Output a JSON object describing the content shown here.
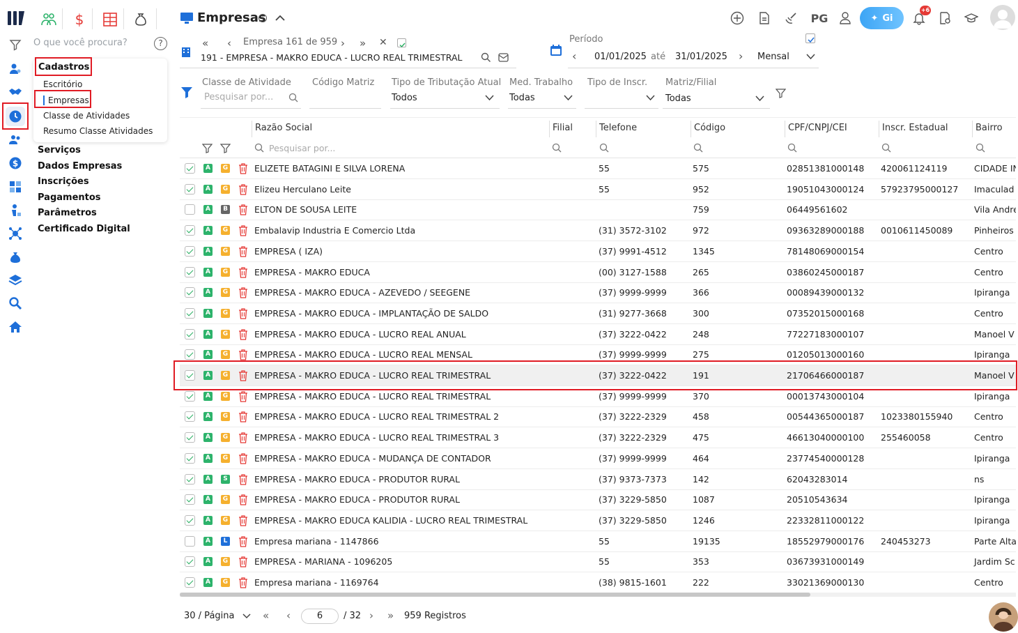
{
  "sidebar": {
    "search_placeholder": "O que você procura?",
    "help": "?",
    "menu": {
      "title": "Cadastros",
      "sub_items": [
        "Escritório",
        "Empresas",
        "Classe de Atividades",
        "Resumo Classe Atividades"
      ],
      "items": [
        "Serviços",
        "Dados Empresas",
        "Inscrições",
        "Pagamentos",
        "Parâmetros",
        "Certificado Digital"
      ]
    }
  },
  "header": {
    "title": "Empresas",
    "pg_label": "PG",
    "gi_label": "Gi",
    "notif_count": "+6"
  },
  "company_nav": {
    "counter": "Empresa 161 de 959",
    "current": "191 - EMPRESA - MAKRO EDUCA - LUCRO REAL TRIMESTRAL"
  },
  "period": {
    "label": "Período",
    "start": "01/01/2025",
    "sep": "até",
    "end": "31/01/2025",
    "mode": "Mensal"
  },
  "filters": {
    "classe_label": "Classe de Atividade",
    "classe_placeholder": "Pesquisar por...",
    "codigo_label": "Código Matriz",
    "tributacao_label": "Tipo de Tributação Atual",
    "tributacao_value": "Todos",
    "med_label": "Med. Trabalho",
    "med_value": "Todas",
    "inscr_label": "Tipo de Inscr.",
    "matriz_label": "Matriz/Filial",
    "matriz_value": "Todas"
  },
  "table": {
    "columns": [
      "Razão Social",
      "Filial",
      "Telefone",
      "Código",
      "CPF/CNPJ/CEI",
      "Inscr. Estadual",
      "Bairro"
    ],
    "search_placeholder": "Pesquisar por...",
    "rows": [
      {
        "checked": true,
        "badge": "G",
        "razao": "ELIZETE BATAGINI E SILVA LORENA",
        "telefone": "55",
        "codigo": "575",
        "cnpj": "02851381000148",
        "ie": "420061124119",
        "bairro": "CIDADE IN"
      },
      {
        "checked": true,
        "badge": "G",
        "razao": "Elizeu Herculano Leite",
        "telefone": "55",
        "codigo": "952",
        "cnpj": "19051043000124",
        "ie": "57923795000127",
        "bairro": "Imaculad"
      },
      {
        "checked": false,
        "badge": "B",
        "razao": "ELTON DE SOUSA LEITE",
        "telefone": "",
        "codigo": "759",
        "cnpj": "06449561602",
        "ie": "",
        "bairro": "Vila Andre"
      },
      {
        "checked": true,
        "badge": "G",
        "razao": "Embalavip Industria E Comercio Ltda",
        "telefone": "(31) 3572-3102",
        "codigo": "972",
        "cnpj": "09363289000188",
        "ie": "0010611450089",
        "bairro": "Pinheiros"
      },
      {
        "checked": true,
        "badge": "G",
        "razao": "EMPRESA ( IZA)",
        "telefone": "(37) 9991-4512",
        "codigo": "1345",
        "cnpj": "78148069000154",
        "ie": "",
        "bairro": "Centro"
      },
      {
        "checked": true,
        "badge": "G",
        "razao": "EMPRESA - MAKRO EDUCA",
        "telefone": "(00) 3127-1588",
        "codigo": "265",
        "cnpj": "03860245000187",
        "ie": "",
        "bairro": "Centro"
      },
      {
        "checked": true,
        "badge": "G",
        "razao": "EMPRESA - MAKRO EDUCA - AZEVEDO / SEEGENE",
        "telefone": "(37) 9999-9999",
        "codigo": "366",
        "cnpj": "00089439000132",
        "ie": "",
        "bairro": "Ipiranga"
      },
      {
        "checked": true,
        "badge": "G",
        "razao": "EMPRESA - MAKRO EDUCA - IMPLANTAÇÃO DE SALDO",
        "telefone": "(31) 9277-3668",
        "codigo": "300",
        "cnpj": "07352015000168",
        "ie": "",
        "bairro": "Centro"
      },
      {
        "checked": true,
        "badge": "G",
        "razao": "EMPRESA - MAKRO EDUCA - LUCRO REAL ANUAL",
        "telefone": "(37) 3222-0422",
        "codigo": "248",
        "cnpj": "77227183000107",
        "ie": "",
        "bairro": "Manoel V"
      },
      {
        "checked": true,
        "badge": "G",
        "razao": "EMPRESA - MAKRO EDUCA - LUCRO REAL MENSAL",
        "telefone": "(37) 9999-9999",
        "codigo": "275",
        "cnpj": "01205013000160",
        "ie": "",
        "bairro": "Ipiranga"
      },
      {
        "checked": true,
        "badge": "G",
        "razao": "EMPRESA - MAKRO EDUCA - LUCRO REAL TRIMESTRAL",
        "telefone": "(37) 3222-0422",
        "codigo": "191",
        "cnpj": "21706466000187",
        "ie": "",
        "bairro": "Manoel V",
        "selected": true
      },
      {
        "checked": true,
        "badge": "G",
        "razao": "EMPRESA - MAKRO EDUCA - LUCRO REAL TRIMESTRAL",
        "telefone": "(37) 9999-9999",
        "codigo": "370",
        "cnpj": "00013743000104",
        "ie": "",
        "bairro": "Ipiranga"
      },
      {
        "checked": true,
        "badge": "G",
        "razao": "EMPRESA - MAKRO EDUCA - LUCRO REAL TRIMESTRAL 2",
        "telefone": "(37) 3222-2329",
        "codigo": "458",
        "cnpj": "00544365000187",
        "ie": "1023380155940",
        "bairro": "Centro"
      },
      {
        "checked": true,
        "badge": "G",
        "razao": "EMPRESA - MAKRO EDUCA - LUCRO REAL TRIMESTRAL 3",
        "telefone": "(37) 3222-2329",
        "codigo": "475",
        "cnpj": "46613040000100",
        "ie": "255460058",
        "bairro": "Centro"
      },
      {
        "checked": true,
        "badge": "G",
        "razao": "EMPRESA - MAKRO EDUCA - MUDANÇA DE CONTADOR",
        "telefone": "(37) 9999-9999",
        "codigo": "464",
        "cnpj": "23774540000128",
        "ie": "",
        "bairro": "Ipiranga"
      },
      {
        "checked": true,
        "badge": "S",
        "razao": "EMPRESA - MAKRO EDUCA - PRODUTOR RURAL",
        "telefone": "(37) 9373-7373",
        "codigo": "142",
        "cnpj": "62043283014",
        "ie": "",
        "bairro": "ns"
      },
      {
        "checked": true,
        "badge": "G",
        "razao": "EMPRESA - MAKRO EDUCA - PRODUTOR RURAL",
        "telefone": "(37) 3229-5850",
        "codigo": "1087",
        "cnpj": "20510543634",
        "ie": "",
        "bairro": "Ipiranga"
      },
      {
        "checked": true,
        "badge": "G",
        "razao": "EMPRESA - MAKRO EDUCA KALIDIA - LUCRO REAL TRIMESTRAL",
        "telefone": "(37) 3229-5850",
        "codigo": "1246",
        "cnpj": "22332811000122",
        "ie": "",
        "bairro": "Ipiranga"
      },
      {
        "checked": false,
        "badge": "L",
        "razao": "Empresa mariana - 1147866",
        "telefone": "55",
        "codigo": "19135",
        "cnpj": "18552979000176",
        "ie": "240453273",
        "bairro": "Parte Alta"
      },
      {
        "checked": true,
        "badge": "G",
        "razao": "EMPRESA - MARIANA - 1096205",
        "telefone": "55",
        "codigo": "353",
        "cnpj": "03673931000149",
        "ie": "",
        "bairro": "Jardim Sc"
      },
      {
        "checked": true,
        "badge": "G",
        "razao": "Empresa mariana - 1169764",
        "telefone": "(38) 9815-1601",
        "codigo": "222",
        "cnpj": "33021369000130",
        "ie": "",
        "bairro": "Centro"
      }
    ]
  },
  "pagination": {
    "per_page": "30 / Página",
    "page": "6",
    "total_pages": "/ 32",
    "records": "959 Registros"
  },
  "colors": {
    "accent": "#1e6fd9",
    "highlight": "#e01b24",
    "badge_A": "#2db36b",
    "badge_G": "#f5b02e",
    "badge_B": "#666666",
    "badge_S": "#2db36b",
    "badge_L": "#1e6fd9"
  }
}
